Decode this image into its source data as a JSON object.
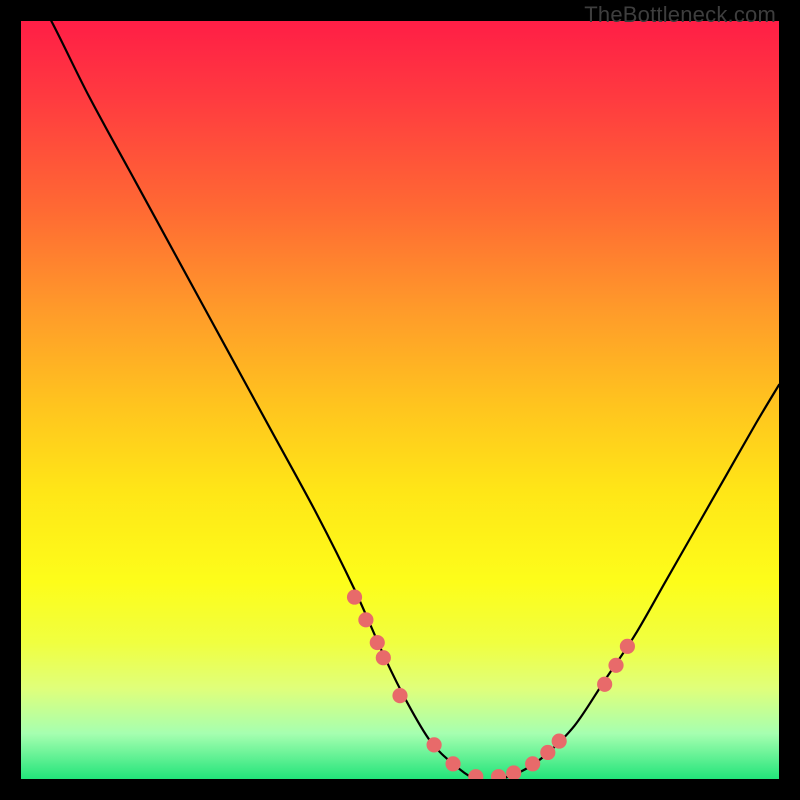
{
  "watermark": {
    "text": "TheBottleneck.com"
  },
  "colors": {
    "background": "#000000",
    "curve_stroke": "#000000",
    "marker_fill": "#e86a6a",
    "marker_stroke": "#b94a4a",
    "gradient_top": "#ff1e46",
    "gradient_bottom": "#22e47a"
  },
  "chart_data": {
    "type": "line",
    "title": "",
    "xlabel": "",
    "ylabel": "",
    "xlim": [
      0,
      100
    ],
    "ylim": [
      0,
      100
    ],
    "grid": false,
    "legend": false,
    "series": [
      {
        "name": "curve",
        "x": [
          0,
          4,
          9,
          15,
          21,
          27,
          33,
          39,
          44,
          48,
          51,
          54,
          57,
          60,
          63,
          66,
          69,
          73,
          77,
          81,
          85,
          89,
          93,
          97,
          100
        ],
        "y": [
          107,
          100,
          90,
          79,
          68,
          57,
          46,
          35,
          25,
          16,
          10,
          5,
          2,
          0,
          0,
          1,
          3,
          7,
          13,
          19,
          26,
          33,
          40,
          47,
          52
        ]
      }
    ],
    "markers": {
      "name": "highlight-points",
      "shape": "circle",
      "radius": 1.0,
      "x": [
        44.0,
        45.5,
        47.0,
        47.8,
        50.0,
        54.5,
        57.0,
        60.0,
        63.0,
        65.0,
        67.5,
        69.5,
        71.0,
        77.0,
        78.5,
        80.0
      ],
      "y": [
        24.0,
        21.0,
        18.0,
        16.0,
        11.0,
        4.5,
        2.0,
        0.3,
        0.3,
        0.8,
        2.0,
        3.5,
        5.0,
        12.5,
        15.0,
        17.5
      ]
    }
  }
}
